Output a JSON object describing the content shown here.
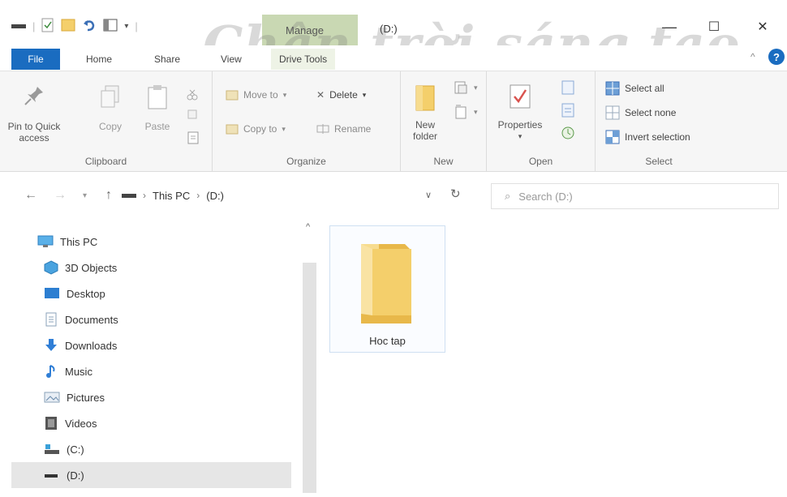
{
  "window": {
    "manage_label": "Manage",
    "title": "(D:)",
    "minimize": "—",
    "maximize": "☐",
    "close": "✕"
  },
  "tabs": [
    {
      "label": "File"
    },
    {
      "label": "Home"
    },
    {
      "label": "Share"
    },
    {
      "label": "View"
    },
    {
      "label": "Drive Tools"
    }
  ],
  "ribbon": {
    "clipboard": {
      "pin_label": "Pin to Quick access",
      "copy_label": "Copy",
      "paste_label": "Paste",
      "group_label": "Clipboard"
    },
    "organize": {
      "move_to": "Move to",
      "delete": "Delete",
      "copy_to": "Copy to",
      "rename": "Rename",
      "group_label": "Organize"
    },
    "new": {
      "new_folder": "New folder",
      "group_label": "New"
    },
    "open": {
      "properties": "Properties",
      "group_label": "Open"
    },
    "select": {
      "select_all": "Select all",
      "select_none": "Select none",
      "invert_selection": "Invert selection",
      "group_label": "Select"
    }
  },
  "address": {
    "crumbs": [
      "This PC",
      "(D:)"
    ],
    "search_placeholder": "Search (D:)"
  },
  "navpane": {
    "items": [
      {
        "label": "This PC",
        "icon": "monitor-icon"
      },
      {
        "label": "3D Objects",
        "icon": "cube-icon"
      },
      {
        "label": "Desktop",
        "icon": "desktop-icon"
      },
      {
        "label": "Documents",
        "icon": "document-icon"
      },
      {
        "label": "Downloads",
        "icon": "download-icon"
      },
      {
        "label": "Music",
        "icon": "music-icon"
      },
      {
        "label": "Pictures",
        "icon": "picture-icon"
      },
      {
        "label": "Videos",
        "icon": "video-icon"
      },
      {
        "label": "(C:)",
        "icon": "drive-icon"
      },
      {
        "label": "(D:)",
        "icon": "drive-icon",
        "selected": true
      }
    ]
  },
  "content": {
    "items": [
      {
        "name": "Hoc tap",
        "icon": "folder-icon"
      }
    ]
  },
  "watermark": {
    "text": "Chân trời sáng tạo"
  },
  "colors": {
    "file_tab": "#1a6cc0",
    "manage_tab": "#c9d8b3",
    "folder": "#f4cf6b",
    "ribbon_bg": "#f6f6f6"
  }
}
